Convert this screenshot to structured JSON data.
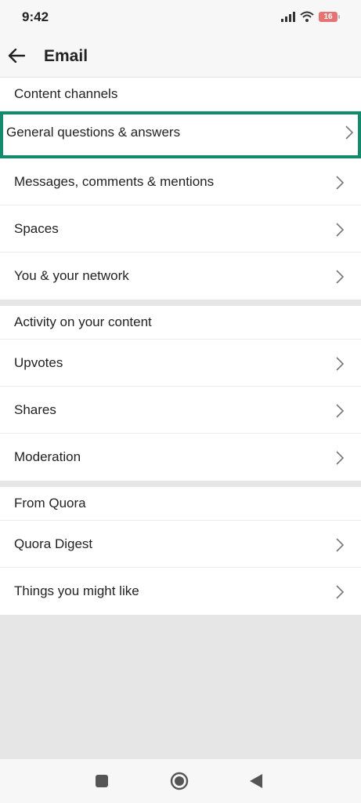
{
  "status": {
    "time": "9:42",
    "battery": "16"
  },
  "header": {
    "title": "Email"
  },
  "sections": [
    {
      "title": "Content channels",
      "items": [
        {
          "label": "General questions & answers"
        },
        {
          "label": "Messages, comments & mentions"
        },
        {
          "label": "Spaces"
        },
        {
          "label": "You & your network"
        }
      ]
    },
    {
      "title": "Activity on your content",
      "items": [
        {
          "label": "Upvotes"
        },
        {
          "label": "Shares"
        },
        {
          "label": "Moderation"
        }
      ]
    },
    {
      "title": "From Quora",
      "items": [
        {
          "label": "Quora Digest"
        },
        {
          "label": "Things you might like"
        }
      ]
    }
  ],
  "colors": {
    "highlight": "#138a6c",
    "background": "#e6e6e6"
  }
}
